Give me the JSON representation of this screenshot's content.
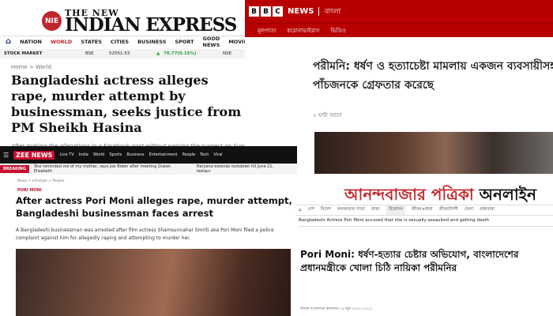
{
  "nie": {
    "logo_mark": "NIE",
    "brand_small": "THE NEW",
    "brand": "INDIAN EXPRESS",
    "nav": [
      "NATION",
      "WORLD",
      "STATES",
      "CITIES",
      "BUSINESS",
      "SPORT",
      "GOOD NEWS",
      "MOVIES"
    ],
    "ticker": {
      "label": "STOCK MARKET",
      "exchange": "BSE",
      "value": "52551.53",
      "change": "76.77(0.15%)",
      "exchange2": "NSE"
    },
    "breadcrumb": "Home  >  World",
    "headline": "Bangladeshi actress alleges rape, murder attempt by businessman, seeks justice from PM Sheikh Hasina",
    "subline": "After making the allegations in a Facebook post without naming the suspect on Sunday, s"
  },
  "bbc": {
    "brand": "NEWS",
    "lang": "বাংলা",
    "nav": [
      "মূলপাতা",
      "করোনাভাইরাস",
      "ভিডিও"
    ],
    "headline": "পরীমনি: ধর্ষণ ও হত্যাচেষ্টা মামলায় একজন ব্যবসায়ীসহ পাঁচজনকে গ্রেফতার করেছে",
    "time": "২ ঘণ্টা আগে"
  },
  "zee": {
    "logo": "ZEE NEWS",
    "nav": [
      "Live TV",
      "India",
      "World",
      "Sports",
      "Business",
      "Entertainment",
      "People",
      "Tech",
      "Viral"
    ],
    "breaking_label": "BREAKING",
    "breaking": [
      "She reminded me of my mother, says Joe Biden after meeting Queen Elizabeth",
      "Haryana extends lockdown till June 21, restaur"
    ],
    "breadcrumb": "News  >  Lifestyle  >  People",
    "section": "PORI MONI",
    "headline": "After actress Pori Moni alleges rape, murder attempt, Bangladeshi businessman faces arrest",
    "summary": "A Bangladeshi businessman was arrested after film actress Shamsunnahar Smriti aka Pori Moni filed a police complaint against him for allegedly raping and attempting to murder her."
  },
  "abp": {
    "logo_red": "আনন্দবাজার পত্রিকা",
    "logo_black": "অনলাইন",
    "nav": [
      "দেশ",
      "বিদেশ",
      "কলকাতার পাতা",
      "রাজ্য",
      "বিনোদন",
      "জীবন+ধারা",
      "জীবনশৈলী",
      "খেলা",
      "রান্নাবান্না"
    ],
    "ticker": "Bangladeshi Actress Pori Moni accused that she is sexually assaulted and getting death",
    "headline_en": "Pori Moni:",
    "headline": " ধর্ষণ-হত্যার চেষ্টার অভিযোগ, বাংলাদেশের প্রধানমন্ত্রীকে খোলা চিঠি নায়িকা পরীমনির",
    "byline": "নিজস্ব সংবাদদাতা   কলকাতা ১৪ জুন ২০২১ ১৩:১১"
  }
}
